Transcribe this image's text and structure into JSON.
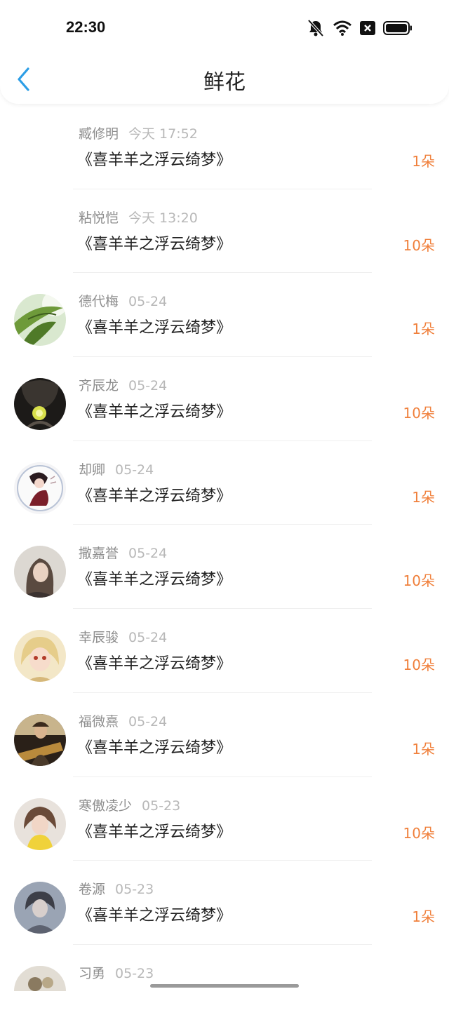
{
  "status_bar": {
    "time": "22:30",
    "icons": [
      "bell-muted-icon",
      "wifi-icon",
      "x-box-icon",
      "battery-icon"
    ]
  },
  "header": {
    "title": "鲜花",
    "back_icon": "chevron-left-icon",
    "accent_color": "#2d9ee6"
  },
  "colors": {
    "amount": "#f0803c",
    "name": "#8e8e8e",
    "date": "#b8b8b8"
  },
  "records": [
    {
      "name": "臧修明",
      "date": "今天 17:52",
      "work": "《喜羊羊之浮云绮梦》",
      "amount": "1朵",
      "avatar": "none"
    },
    {
      "name": "粘悦恺",
      "date": "今天 13:20",
      "work": "《喜羊羊之浮云绮梦》",
      "amount": "10朵",
      "avatar": "none"
    },
    {
      "name": "德代梅",
      "date": "05-24",
      "work": "《喜羊羊之浮云绮梦》",
      "amount": "1朵",
      "avatar": "leaf-photo"
    },
    {
      "name": "齐辰龙",
      "date": "05-24",
      "work": "《喜羊羊之浮云绮梦》",
      "amount": "10朵",
      "avatar": "dark-figure-photo"
    },
    {
      "name": "却卿",
      "date": "05-24",
      "work": "《喜羊羊之浮云绮梦》",
      "amount": "1朵",
      "avatar": "anime-illustration"
    },
    {
      "name": "撒嘉誉",
      "date": "05-24",
      "work": "《喜羊羊之浮云绮梦》",
      "amount": "10朵",
      "avatar": "girl-portrait-photo"
    },
    {
      "name": "幸辰骏",
      "date": "05-24",
      "work": "《喜羊羊之浮云绮梦》",
      "amount": "10朵",
      "avatar": "doll-photo"
    },
    {
      "name": "福微熹",
      "date": "05-24",
      "work": "《喜羊羊之浮云绮梦》",
      "amount": "1朵",
      "avatar": "man-guitar-photo"
    },
    {
      "name": "寒傲凌少",
      "date": "05-23",
      "work": "《喜羊羊之浮云绮梦》",
      "amount": "10朵",
      "avatar": "child-yellow-dress-photo"
    },
    {
      "name": "卷源",
      "date": "05-23",
      "work": "《喜羊羊之浮云绮梦》",
      "amount": "1朵",
      "avatar": "grey-portrait-photo"
    },
    {
      "name": "习勇",
      "date": "05-23",
      "work": "",
      "amount": "",
      "avatar": "partial-photo"
    }
  ]
}
